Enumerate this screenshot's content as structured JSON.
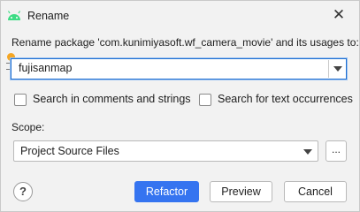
{
  "window": {
    "title": "Rename",
    "app_icon": "android-icon",
    "close_icon": "close-icon"
  },
  "prompt": "Rename package 'com.kunimiyasoft.wf_camera_movie' and its usages to:",
  "new_name": {
    "value": "fujisanmap"
  },
  "options": [
    {
      "label": "Search in comments and strings",
      "checked": false
    },
    {
      "label": "Search for text occurrences",
      "checked": false
    }
  ],
  "scope": {
    "label": "Scope:",
    "value": "Project Source Files",
    "browse_label": "..."
  },
  "buttons": {
    "help": "?",
    "refactor": "Refactor",
    "preview": "Preview",
    "cancel": "Cancel"
  },
  "colors": {
    "primary": "#3574f0",
    "focus": "#1f6fd1",
    "marker": "#f5a623",
    "android": "#3ddc84"
  }
}
